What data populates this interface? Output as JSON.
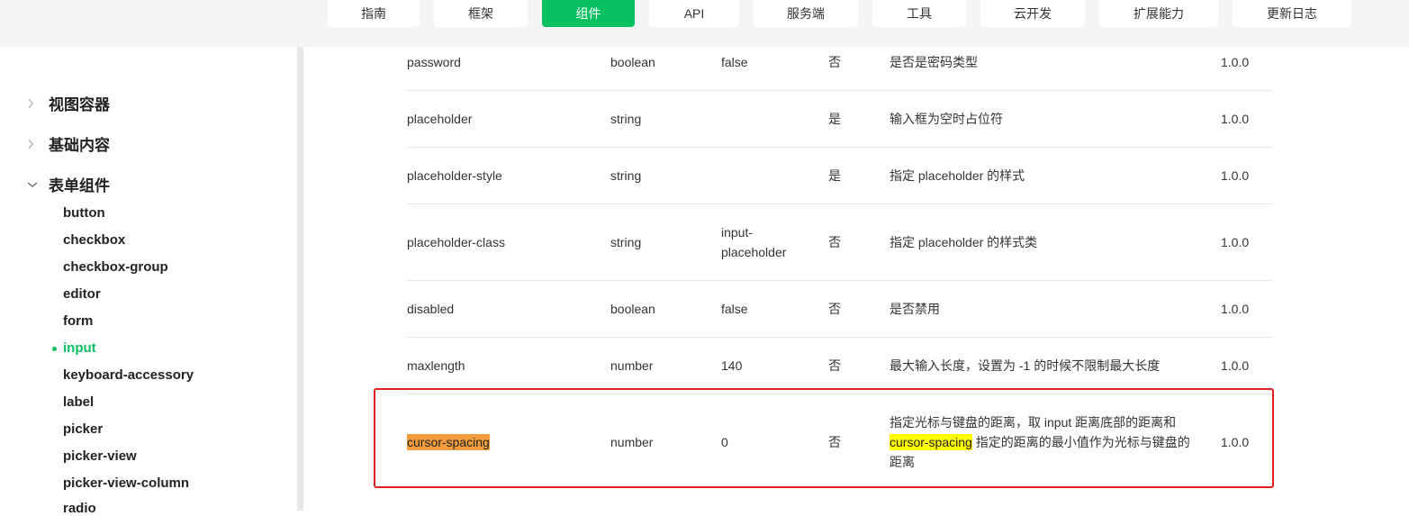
{
  "nav": {
    "tabs": [
      {
        "label": "指南",
        "active": false
      },
      {
        "label": "框架",
        "active": false
      },
      {
        "label": "组件",
        "active": true
      },
      {
        "label": "API",
        "active": false
      },
      {
        "label": "服务端",
        "active": false
      },
      {
        "label": "工具",
        "active": false
      },
      {
        "label": "云开发",
        "active": false
      },
      {
        "label": "扩展能力",
        "active": false
      },
      {
        "label": "更新日志",
        "active": false
      }
    ]
  },
  "sidebar": {
    "groups": [
      {
        "label": "视图容器",
        "expanded": false
      },
      {
        "label": "基础内容",
        "expanded": false
      },
      {
        "label": "表单组件",
        "expanded": true
      }
    ],
    "items": [
      {
        "label": "button"
      },
      {
        "label": "checkbox"
      },
      {
        "label": "checkbox-group"
      },
      {
        "label": "editor"
      },
      {
        "label": "form"
      },
      {
        "label": "input",
        "active": true
      },
      {
        "label": "keyboard-accessory"
      },
      {
        "label": "label"
      },
      {
        "label": "picker"
      },
      {
        "label": "picker-view"
      },
      {
        "label": "picker-view-column"
      },
      {
        "label": "radio"
      }
    ]
  },
  "table": {
    "rows": [
      {
        "name": "password",
        "type": "boolean",
        "default": "false",
        "required": "否",
        "desc": "是否是密码类型",
        "version": "1.0.0"
      },
      {
        "name": "placeholder",
        "type": "string",
        "default": "",
        "required": "是",
        "desc": "输入框为空时占位符",
        "version": "1.0.0"
      },
      {
        "name": "placeholder-style",
        "type": "string",
        "default": "",
        "required": "是",
        "desc": "指定 placeholder 的样式",
        "version": "1.0.0"
      },
      {
        "name": "placeholder-class",
        "type": "string",
        "default_line1": "input-",
        "default_line2": "placeholder",
        "required": "否",
        "desc": "指定 placeholder 的样式类",
        "version": "1.0.0"
      },
      {
        "name": "disabled",
        "type": "boolean",
        "default": "false",
        "required": "否",
        "desc": "是否禁用",
        "version": "1.0.0"
      },
      {
        "name": "maxlength",
        "type": "number",
        "default": "140",
        "required": "否",
        "desc": "最大输入长度，设置为 -1 的时候不限制最大长度",
        "version": "1.0.0"
      },
      {
        "name": "cursor-spacing",
        "type": "number",
        "default": "0",
        "required": "否",
        "desc_pre": "指定光标与键盘的距离，取 input 距离底部的距离和",
        "desc_hl": "cursor-spacing",
        "desc_post": " 指定的距离的最小值作为光标与键盘的距离",
        "version": "1.0.0"
      }
    ]
  },
  "colors": {
    "accent": "#07c160",
    "highlight_box": "#e02020",
    "hl_orange": "#f39c3c",
    "hl_yellow": "#ffff00"
  }
}
